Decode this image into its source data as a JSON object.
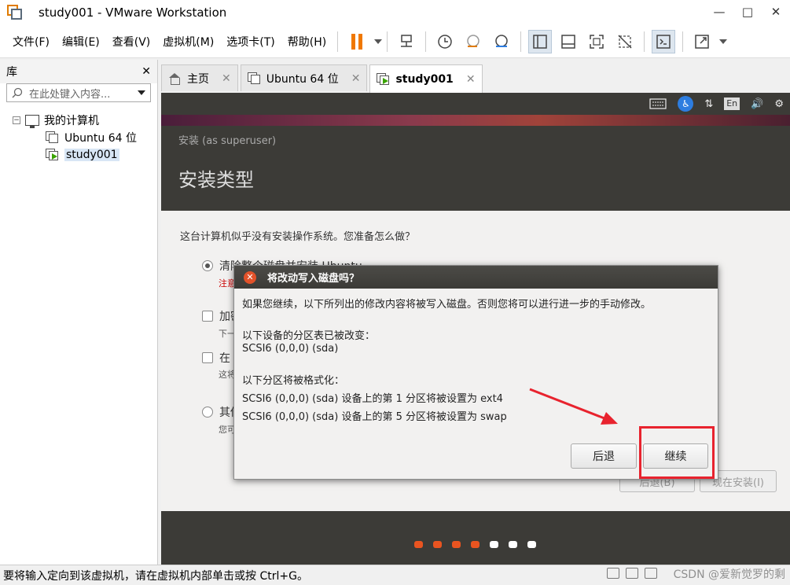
{
  "window": {
    "title": "study001 - VMware Workstation",
    "controls": {
      "minimize": "—",
      "maximize": "□",
      "close": "✕"
    }
  },
  "menu": {
    "items": [
      "文件(F)",
      "编辑(E)",
      "查看(V)",
      "虚拟机(M)",
      "选项卡(T)",
      "帮助(H)"
    ]
  },
  "library": {
    "title": "库",
    "close": "✕",
    "search_placeholder": "在此处键入内容...",
    "root_label": "我的计算机",
    "expander": "−",
    "vms": [
      "Ubuntu 64 位",
      "study001"
    ],
    "selected_vm": "study001"
  },
  "tabs": [
    {
      "label": "主页",
      "close": "✕"
    },
    {
      "label": "Ubuntu 64 位",
      "close": "✕"
    },
    {
      "label": "study001",
      "close": "✕",
      "active": true
    }
  ],
  "vm_topbar": {
    "language": "En",
    "accessibility": "♿",
    "network": "⇅",
    "volume": "🔊",
    "settings": "⚙"
  },
  "installer": {
    "subtitle": "安装 (as superuser)",
    "heading": "安装类型",
    "question": "这台计算机似乎没有安装操作系统。您准备怎么做？",
    "options": [
      {
        "label": "清除整个磁盘并安装 Ubuntu",
        "hint": "注意",
        "kind": "radio",
        "selected": true
      },
      {
        "label": "加密",
        "hint": "下一",
        "kind": "check"
      },
      {
        "label": "在 U",
        "hint": "这将",
        "kind": "check"
      },
      {
        "label": "其他",
        "hint": "您可",
        "kind": "radio",
        "selected": false
      }
    ],
    "back_label": "后退(B)",
    "install_now_label": "现在安装(I)"
  },
  "progress_dots": {
    "total": 7,
    "done": 4,
    "done_color": "#e95420",
    "todo_color": "#ffffff"
  },
  "dialog": {
    "title": "将改动写入磁盘吗？",
    "close": "✕",
    "intro": "如果您继续，以下所列出的修改内容将被写入磁盘。否则您将可以进行进一步的手动修改。",
    "partition_table_heading": "以下设备的分区表已被改变：",
    "partition_table_device": "SCSI6 (0,0,0) (sda)",
    "format_heading": "以下分区将被格式化：",
    "format_lines": [
      "SCSI6 (0,0,0) (sda) 设备上的第 1 分区将被设置为 ext4",
      "SCSI6 (0,0,0) (sda) 设备上的第 5 分区将被设置为 swap"
    ],
    "back_button": "后退",
    "continue_button": "继续"
  },
  "annotation": {
    "highlight_color": "#e8232e"
  },
  "statusbar": {
    "message": "要将输入定向到该虚拟机，请在虚拟机内部单击或按 Ctrl+G。",
    "watermark": "CSDN @爱新觉罗的剩"
  }
}
